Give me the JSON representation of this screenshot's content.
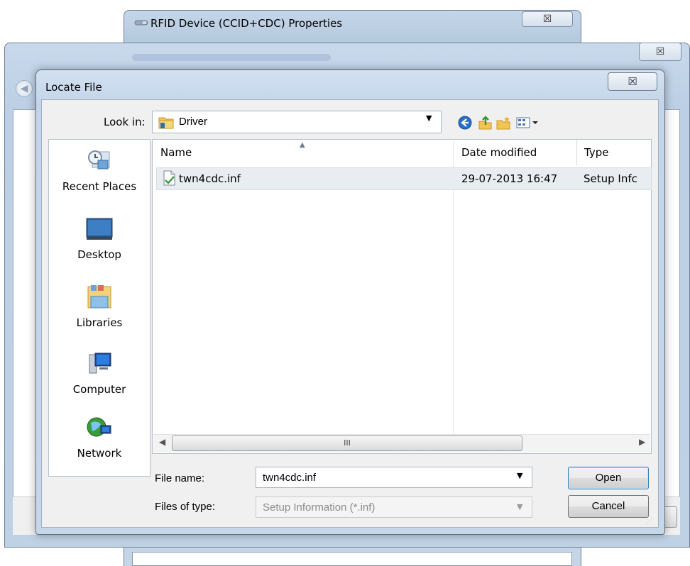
{
  "background": {
    "back_window": {
      "title": "RFID Device (CCID+CDC) Properties",
      "close_glyph": "☒"
    },
    "middle_window": {
      "close_glyph": "☒"
    }
  },
  "dialog": {
    "title": "Locate File",
    "close_glyph": "☒",
    "look_in": {
      "label": "Look in:",
      "value": "Driver"
    },
    "toolbar": [
      "back-icon",
      "up-folder-icon",
      "new-folder-icon",
      "view-menu-icon"
    ],
    "places": [
      {
        "name": "recent-places",
        "label": "Recent Places"
      },
      {
        "name": "desktop",
        "label": "Desktop"
      },
      {
        "name": "libraries",
        "label": "Libraries"
      },
      {
        "name": "computer",
        "label": "Computer"
      },
      {
        "name": "network",
        "label": "Network"
      }
    ],
    "columns": {
      "name": "Name",
      "date": "Date modified",
      "type": "Type"
    },
    "files": [
      {
        "name": "twn4cdc.inf",
        "date": "29-07-2013 16:47",
        "type": "Setup Infc"
      }
    ],
    "scrollbar": {
      "thumb_grip": "III"
    },
    "file_name": {
      "label": "File name:",
      "value": "twn4cdc.inf"
    },
    "file_type": {
      "label": "Files of type:",
      "value": "Setup Information (*.inf)"
    },
    "buttons": {
      "open": "Open",
      "cancel": "Cancel"
    }
  }
}
